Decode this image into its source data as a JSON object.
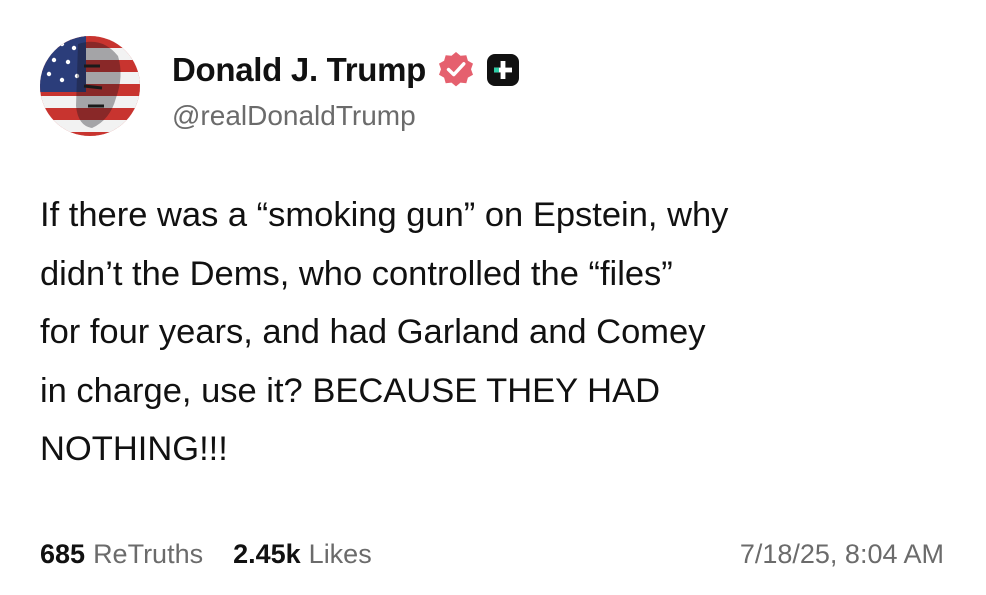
{
  "post": {
    "author": {
      "display_name": "Donald J. Trump",
      "handle": "@realDonaldTrump",
      "verified_icon": "verified-badge-icon",
      "badge_icon": "truth-plus-icon",
      "accent_color": "#e5606e"
    },
    "body": "If there was a “smoking gun” on Epstein, why\ndidn’t the Dems, who controlled the “files”\nfor four years, and had Garland and Comey\nin charge, use it? BECAUSE THEY HAD\nNOTHING!!!",
    "stats": {
      "retruths_count": "685",
      "retruths_label": "ReTruths",
      "likes_count": "2.45k",
      "likes_label": "Likes"
    },
    "timestamp": "7/18/25, 8:04 AM"
  }
}
